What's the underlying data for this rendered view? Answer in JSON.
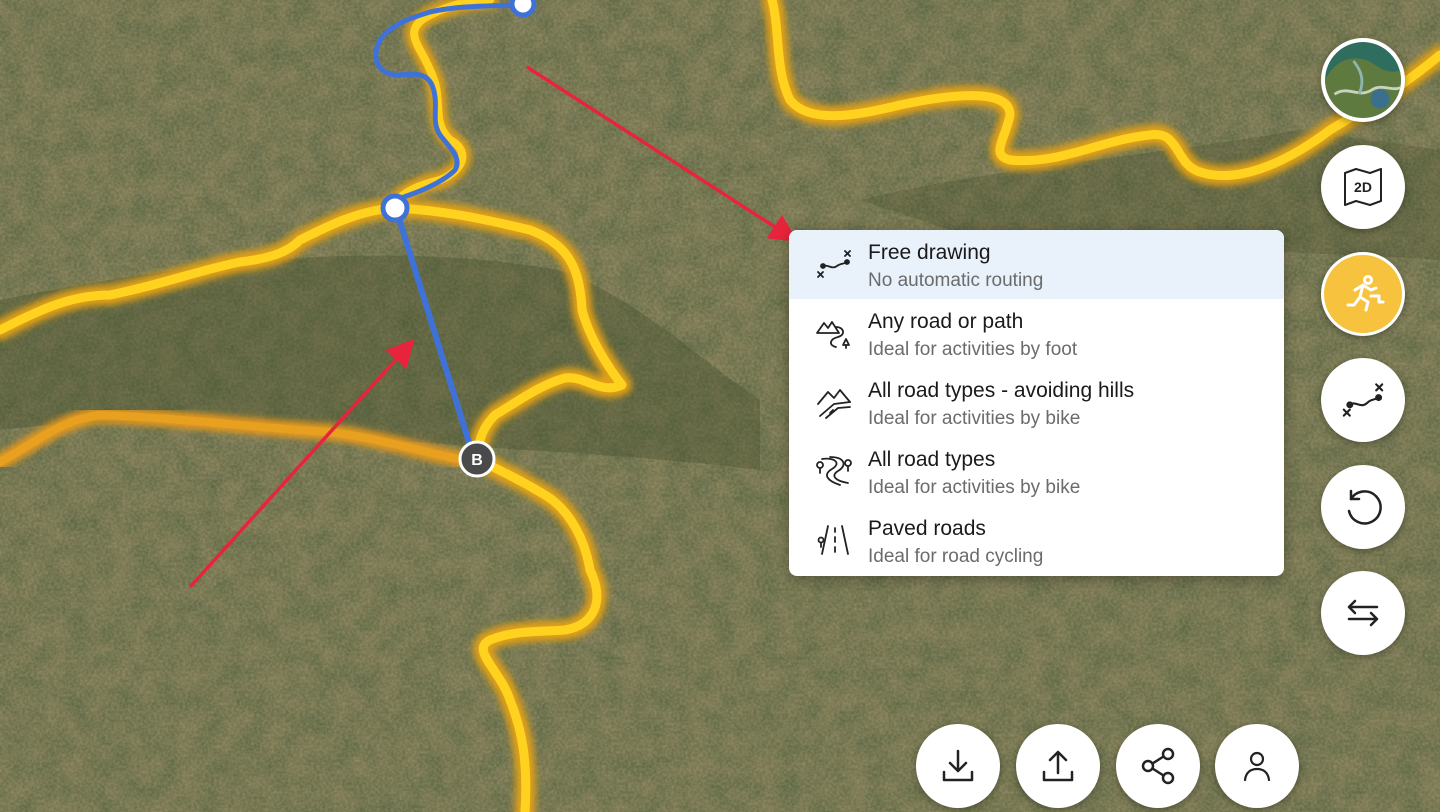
{
  "map": {
    "marker_b_label": "B",
    "colors": {
      "route_yellow": "#ffd21f",
      "route_orange": "#e79a1a",
      "drawn_route": "#3f72d8",
      "annotation_arrow": "#e8243c"
    }
  },
  "routing_menu": {
    "items": [
      {
        "title": "Free drawing",
        "subtitle": "No automatic routing",
        "icon": "free-drawing-icon",
        "selected": true
      },
      {
        "title": "Any road or path",
        "subtitle": "Ideal for activities by foot",
        "icon": "trail-icon",
        "selected": false
      },
      {
        "title": "All road types - avoiding hills",
        "subtitle": "Ideal for activities by bike",
        "icon": "hills-road-icon",
        "selected": false
      },
      {
        "title": "All road types",
        "subtitle": "Ideal for activities by bike",
        "icon": "winding-road-icon",
        "selected": false
      },
      {
        "title": "Paved roads",
        "subtitle": "Ideal for road cycling",
        "icon": "paved-road-icon",
        "selected": false
      }
    ]
  },
  "right_toolbar": {
    "layer_toggle": "globe-thumbnail-icon",
    "view_mode": "2D",
    "activity": "runner-icon",
    "routing_mode": "free-drawing-icon",
    "undo": "undo-icon",
    "reverse": "swap-arrows-icon"
  },
  "bottom_toolbar": [
    "download-icon",
    "upload-icon",
    "share-icon",
    "user-icon"
  ]
}
